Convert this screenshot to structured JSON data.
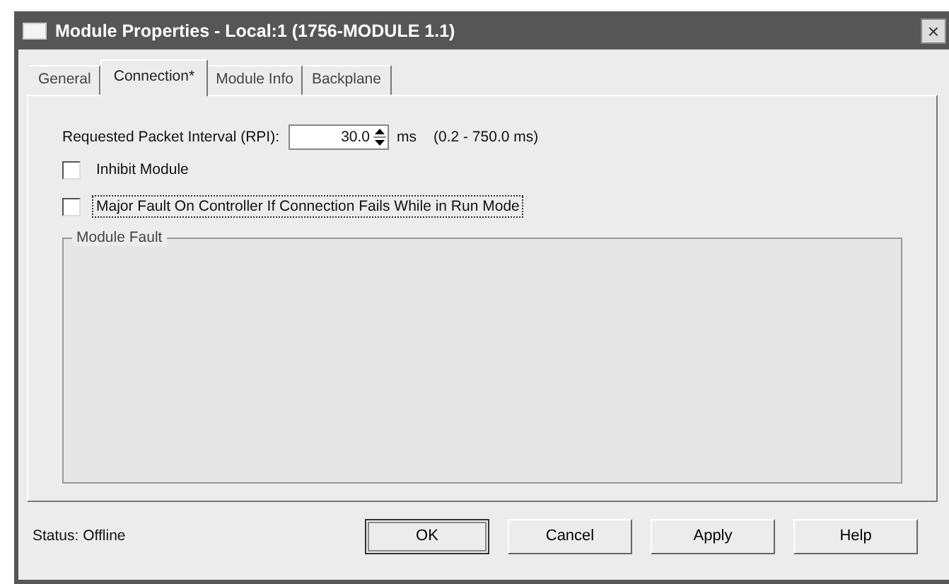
{
  "window": {
    "title": "Module Properties - Local:1 (1756-MODULE 1.1)",
    "close": "×"
  },
  "tabs": [
    {
      "label": "General",
      "selected": false
    },
    {
      "label": "Connection*",
      "selected": true
    },
    {
      "label": "Module Info",
      "selected": false
    },
    {
      "label": "Backplane",
      "selected": false
    }
  ],
  "rpi": {
    "label": "Requested Packet Interval (RPI):",
    "value": "30.0",
    "unit": "ms",
    "range": "(0.2 - 750.0 ms)"
  },
  "options": [
    {
      "label": "Inhibit Module",
      "checked": false,
      "focused": false
    },
    {
      "label": "Major Fault On Controller If Connection Fails While in Run Mode",
      "checked": false,
      "focused": true
    }
  ],
  "module_fault": {
    "title": "Module Fault"
  },
  "status": "Status:  Offline",
  "buttons": [
    {
      "label": "OK",
      "default": true
    },
    {
      "label": "Cancel",
      "default": false
    },
    {
      "label": "Apply",
      "default": false
    },
    {
      "label": "Help",
      "default": false
    }
  ]
}
